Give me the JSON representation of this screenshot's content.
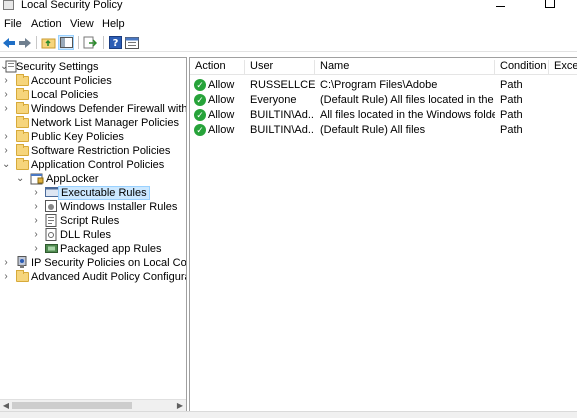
{
  "window": {
    "title": "Local Security Policy"
  },
  "menu": [
    {
      "label": "File"
    },
    {
      "label": "Action"
    },
    {
      "label": "View"
    },
    {
      "label": "Help"
    }
  ],
  "toolbar": {
    "icons": [
      "back-arrow-icon",
      "forward-arrow-icon",
      "up-folder-icon",
      "show-hide-tree-icon",
      "export-list-icon",
      "help-icon",
      "properties-icon"
    ]
  },
  "tree": {
    "items": [
      {
        "label": "Security Settings",
        "chevron": "⌄",
        "icon": "security-settings-icon"
      },
      {
        "label": "Account Policies",
        "chevron": "›",
        "icon": "folder-icon"
      },
      {
        "label": "Local Policies",
        "chevron": "›",
        "icon": "folder-icon"
      },
      {
        "label": "Windows Defender Firewall with Adva",
        "chevron": "›",
        "icon": "folder-icon"
      },
      {
        "label": "Network List Manager Policies",
        "chevron": "",
        "icon": "folder-icon"
      },
      {
        "label": "Public Key Policies",
        "chevron": "›",
        "icon": "folder-icon"
      },
      {
        "label": "Software Restriction Policies",
        "chevron": "›",
        "icon": "folder-icon"
      },
      {
        "label": "Application Control Policies",
        "chevron": "⌄",
        "icon": "folder-icon"
      },
      {
        "label": "AppLocker",
        "chevron": "⌄",
        "icon": "applocker-icon"
      },
      {
        "label": "Executable Rules",
        "chevron": "›",
        "icon": "executable-rules-icon"
      },
      {
        "label": "Windows Installer Rules",
        "chevron": "›",
        "icon": "installer-rules-icon"
      },
      {
        "label": "Script Rules",
        "chevron": "›",
        "icon": "script-rules-icon"
      },
      {
        "label": "DLL Rules",
        "chevron": "›",
        "icon": "dll-rules-icon"
      },
      {
        "label": "Packaged app Rules",
        "chevron": "›",
        "icon": "packaged-app-rules-icon"
      },
      {
        "label": "IP Security Policies on Local Compute",
        "chevron": "›",
        "icon": "ip-security-icon"
      },
      {
        "label": "Advanced Audit Policy Configuration",
        "chevron": "›",
        "icon": "folder-icon"
      }
    ]
  },
  "list": {
    "columns": [
      {
        "label": "Action"
      },
      {
        "label": "User"
      },
      {
        "label": "Name"
      },
      {
        "label": "Condition"
      },
      {
        "label": "Excepti"
      }
    ],
    "rows": [
      {
        "action": "Allow",
        "user": "RUSSELLCEL...",
        "name": "C:\\Program Files\\Adobe",
        "condition": "Path",
        "exceptions": ""
      },
      {
        "action": "Allow",
        "user": "Everyone",
        "name": "(Default Rule) All files located in the Pro...",
        "condition": "Path",
        "exceptions": ""
      },
      {
        "action": "Allow",
        "user": "BUILTIN\\Ad...",
        "name": "All files located in the Windows folder",
        "condition": "Path",
        "exceptions": ""
      },
      {
        "action": "Allow",
        "user": "BUILTIN\\Ad...",
        "name": "(Default Rule) All files",
        "condition": "Path",
        "exceptions": ""
      }
    ]
  },
  "colors": {
    "selection": "#cce8ff",
    "allow": "#27a33a",
    "folder": "#f6d57c"
  }
}
